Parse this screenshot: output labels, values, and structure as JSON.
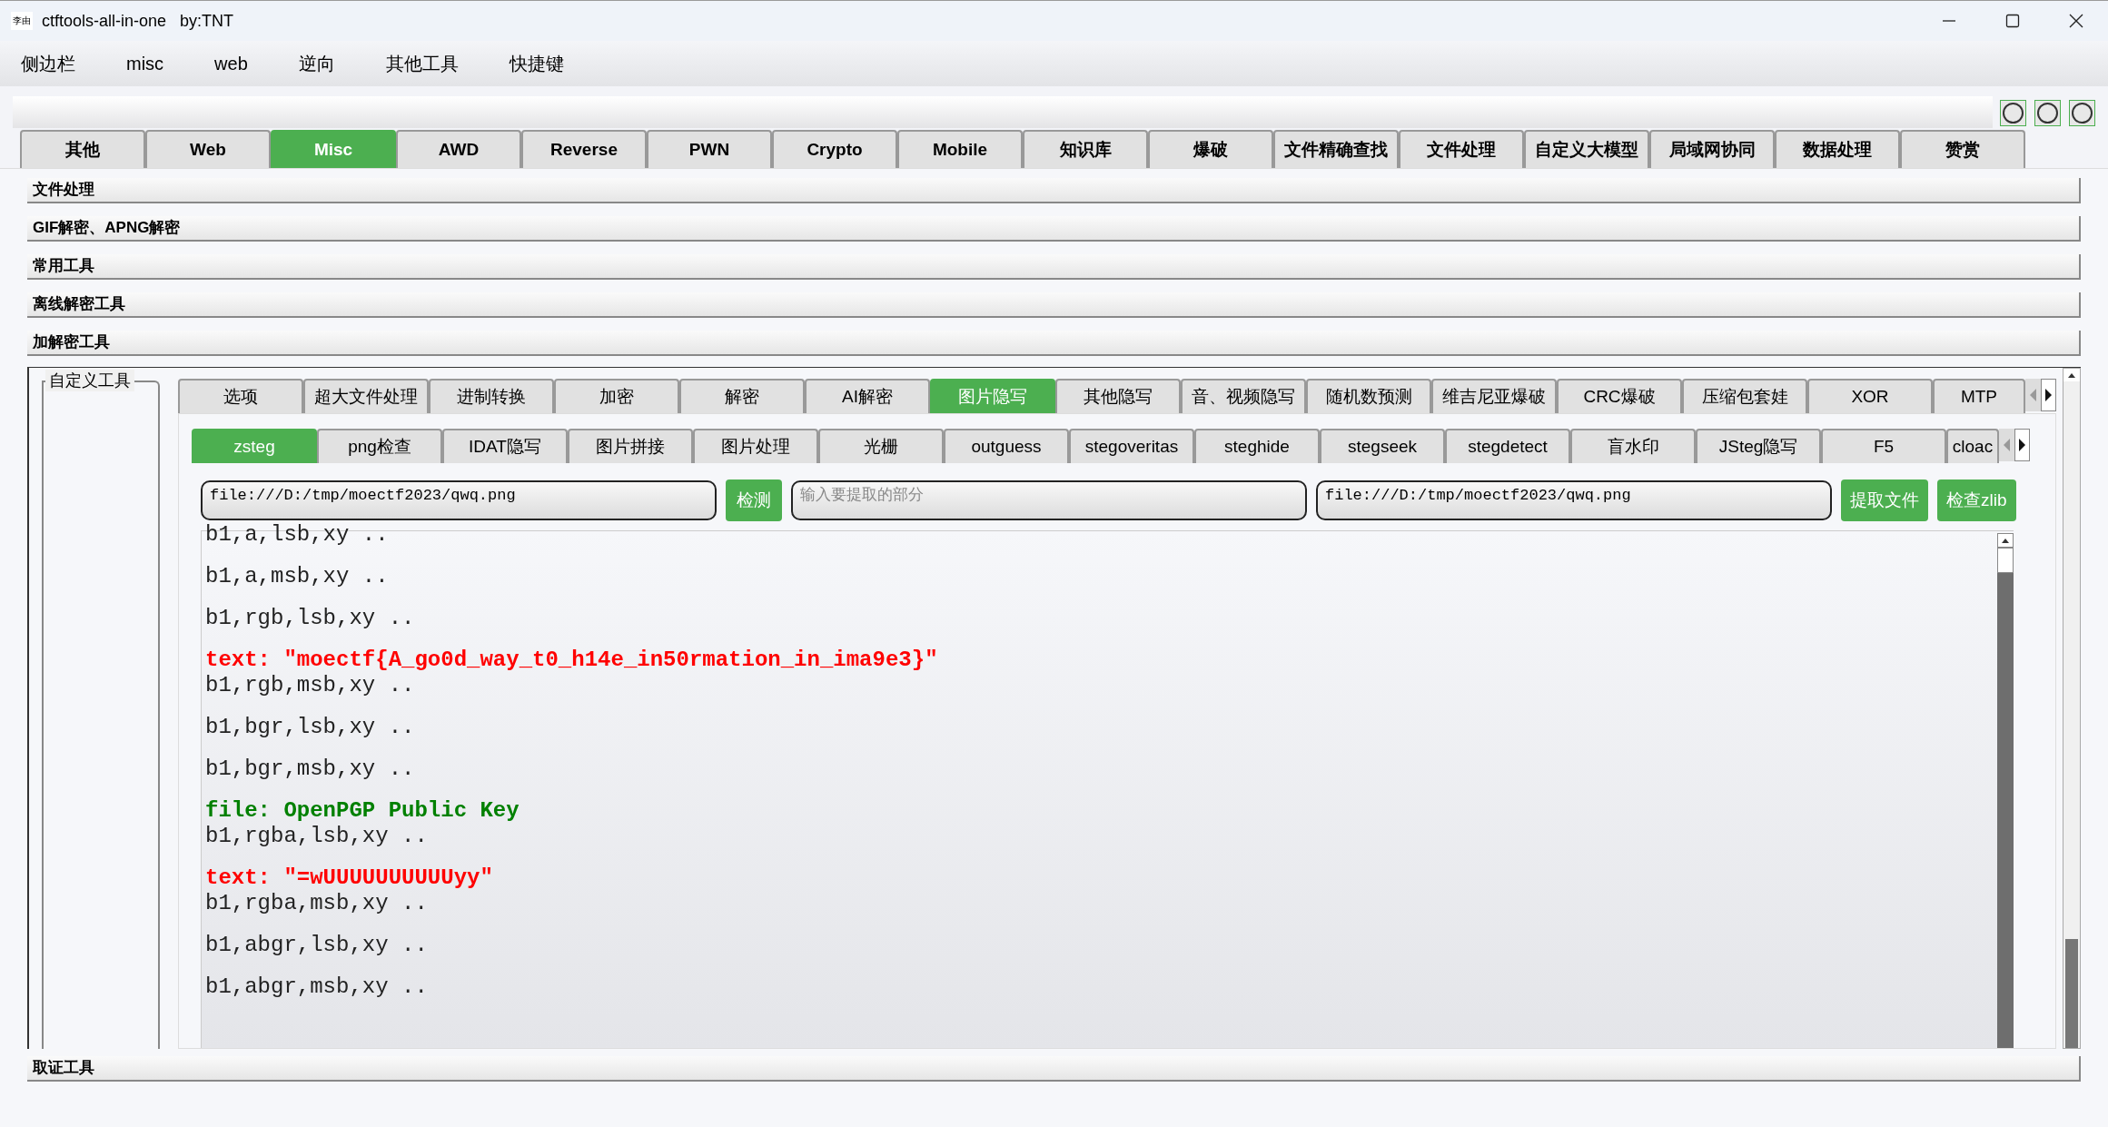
{
  "window": {
    "title": "ctftools-all-in-one   by:TNT",
    "app_icon_text": "李由"
  },
  "menu": [
    "侧边栏",
    "misc",
    "web",
    "逆向",
    "其他工具",
    "快捷键"
  ],
  "main_tabs": [
    {
      "label": "其他",
      "selected": false
    },
    {
      "label": "Web",
      "selected": false
    },
    {
      "label": "Misc",
      "selected": true
    },
    {
      "label": "AWD",
      "selected": false
    },
    {
      "label": "Reverse",
      "selected": false
    },
    {
      "label": "PWN",
      "selected": false
    },
    {
      "label": "Crypto",
      "selected": false
    },
    {
      "label": "Mobile",
      "selected": false
    },
    {
      "label": "知识库",
      "selected": false
    },
    {
      "label": "爆破",
      "selected": false
    },
    {
      "label": "文件精确查找",
      "selected": false
    },
    {
      "label": "文件处理",
      "selected": false
    },
    {
      "label": "自定义大模型",
      "selected": false
    },
    {
      "label": "局域网协同",
      "selected": false
    },
    {
      "label": "数据处理",
      "selected": false
    },
    {
      "label": "赞赏",
      "selected": false
    }
  ],
  "sections": [
    "文件处理",
    "GIF解密、APNG解密",
    "常用工具",
    "离线解密工具",
    "加解密工具"
  ],
  "custom_tools_group": {
    "title": "自定义工具"
  },
  "tool_tabs": [
    {
      "label": "选项",
      "selected": false
    },
    {
      "label": "超大文件处理",
      "selected": false
    },
    {
      "label": "进制转换",
      "selected": false
    },
    {
      "label": "加密",
      "selected": false
    },
    {
      "label": "解密",
      "selected": false
    },
    {
      "label": "AI解密",
      "selected": false
    },
    {
      "label": "图片隐写",
      "selected": true
    },
    {
      "label": "其他隐写",
      "selected": false
    },
    {
      "label": "音、视频隐写",
      "selected": false
    },
    {
      "label": "随机数预测",
      "selected": false
    },
    {
      "label": "维吉尼亚爆破",
      "selected": false
    },
    {
      "label": "CRC爆破",
      "selected": false
    },
    {
      "label": "压缩包套娃",
      "selected": false
    },
    {
      "label": "XOR",
      "selected": false
    },
    {
      "label": "MTP",
      "selected": false
    }
  ],
  "stego_tabs": [
    {
      "label": "zsteg",
      "selected": true
    },
    {
      "label": "png检查",
      "selected": false
    },
    {
      "label": "IDAT隐写",
      "selected": false
    },
    {
      "label": "图片拼接",
      "selected": false
    },
    {
      "label": "图片处理",
      "selected": false
    },
    {
      "label": "光栅",
      "selected": false
    },
    {
      "label": "outguess",
      "selected": false
    },
    {
      "label": "stegoveritas",
      "selected": false
    },
    {
      "label": "steghide",
      "selected": false
    },
    {
      "label": "stegseek",
      "selected": false
    },
    {
      "label": "stegdetect",
      "selected": false
    },
    {
      "label": "盲水印",
      "selected": false
    },
    {
      "label": "JSteg隐写",
      "selected": false
    },
    {
      "label": "F5",
      "selected": false
    },
    {
      "label": "cloac",
      "selected": false
    }
  ],
  "file_input": {
    "value": "file:///D:/tmp/moectf2023/qwq.png"
  },
  "detect_button": "检测",
  "extract_input": {
    "placeholder": "输入要提取的部分"
  },
  "output_file_input": {
    "value": "file:///D:/tmp/moectf2023/qwq.png"
  },
  "extract_button": "提取文件",
  "zlib_button": "检查zlib",
  "output_lines": [
    {
      "kind": "plain",
      "text": "b1,a,lsb,xy .."
    },
    {
      "kind": "plain",
      "text": "b1,a,msb,xy .."
    },
    {
      "kind": "plain",
      "text": "b1,rgb,lsb,xy .."
    },
    {
      "kind": "text",
      "text": "text: \"moectf{A_go0d_way_t0_h14e_in50rmation_in_ima9e3}\""
    },
    {
      "kind": "plain",
      "text": "b1,rgb,msb,xy .."
    },
    {
      "kind": "plain",
      "text": "b1,bgr,lsb,xy .."
    },
    {
      "kind": "plain",
      "text": "b1,bgr,msb,xy .."
    },
    {
      "kind": "file",
      "text": "file: OpenPGP Public Key"
    },
    {
      "kind": "plain",
      "text": "b1,rgba,lsb,xy .."
    },
    {
      "kind": "text",
      "text": "text: \"=wUUUUUUUUUUyy\""
    },
    {
      "kind": "plain",
      "text": "b1,rgba,msb,xy .."
    },
    {
      "kind": "plain",
      "text": "b1,abgr,lsb,xy .."
    },
    {
      "kind": "plain",
      "text": "b1,abgr,msb,xy .."
    }
  ],
  "bottom_section": "取证工具"
}
